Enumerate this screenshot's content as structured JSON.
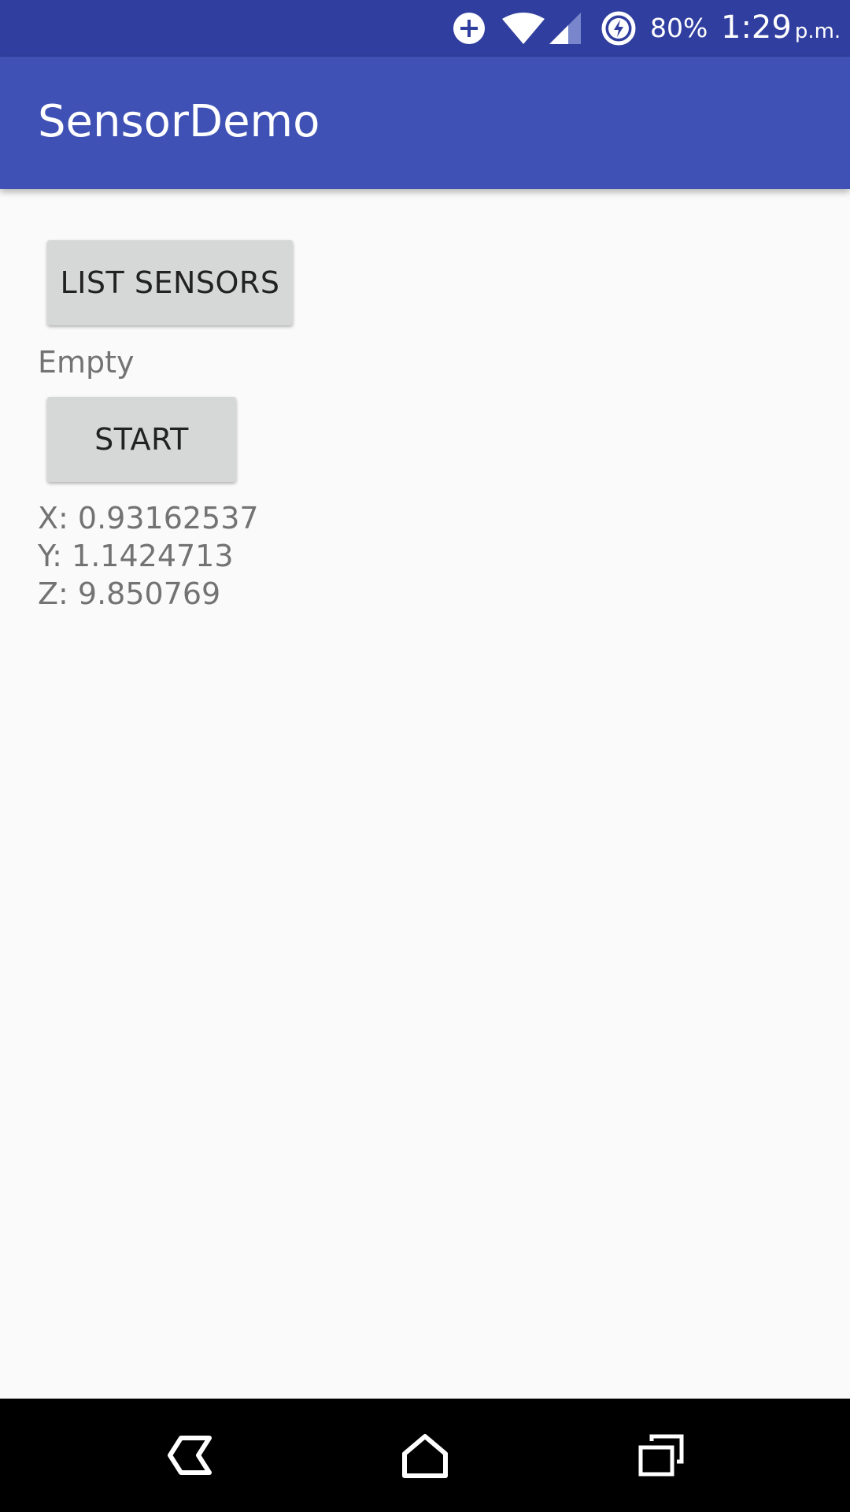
{
  "status_bar": {
    "battery_percent": "80%",
    "time": "1:29",
    "ampm": "p.m.",
    "icons": [
      "data-saver-plus-icon",
      "wifi-icon",
      "cell-signal-icon",
      "battery-charging-icon"
    ],
    "background_color": "#303f9f"
  },
  "app_bar": {
    "title": "SensorDemo",
    "background_color": "#3f51b5"
  },
  "main": {
    "list_sensors_label": "LIST SENSORS",
    "sensor_list_text": "Empty",
    "start_label": "START",
    "axis_x": "X: 0.93162537",
    "axis_y": "Y: 1.1424713",
    "axis_z": "Z: 9.850769"
  },
  "nav_bar": {
    "icons": [
      "back-icon",
      "home-icon",
      "recents-icon"
    ]
  }
}
